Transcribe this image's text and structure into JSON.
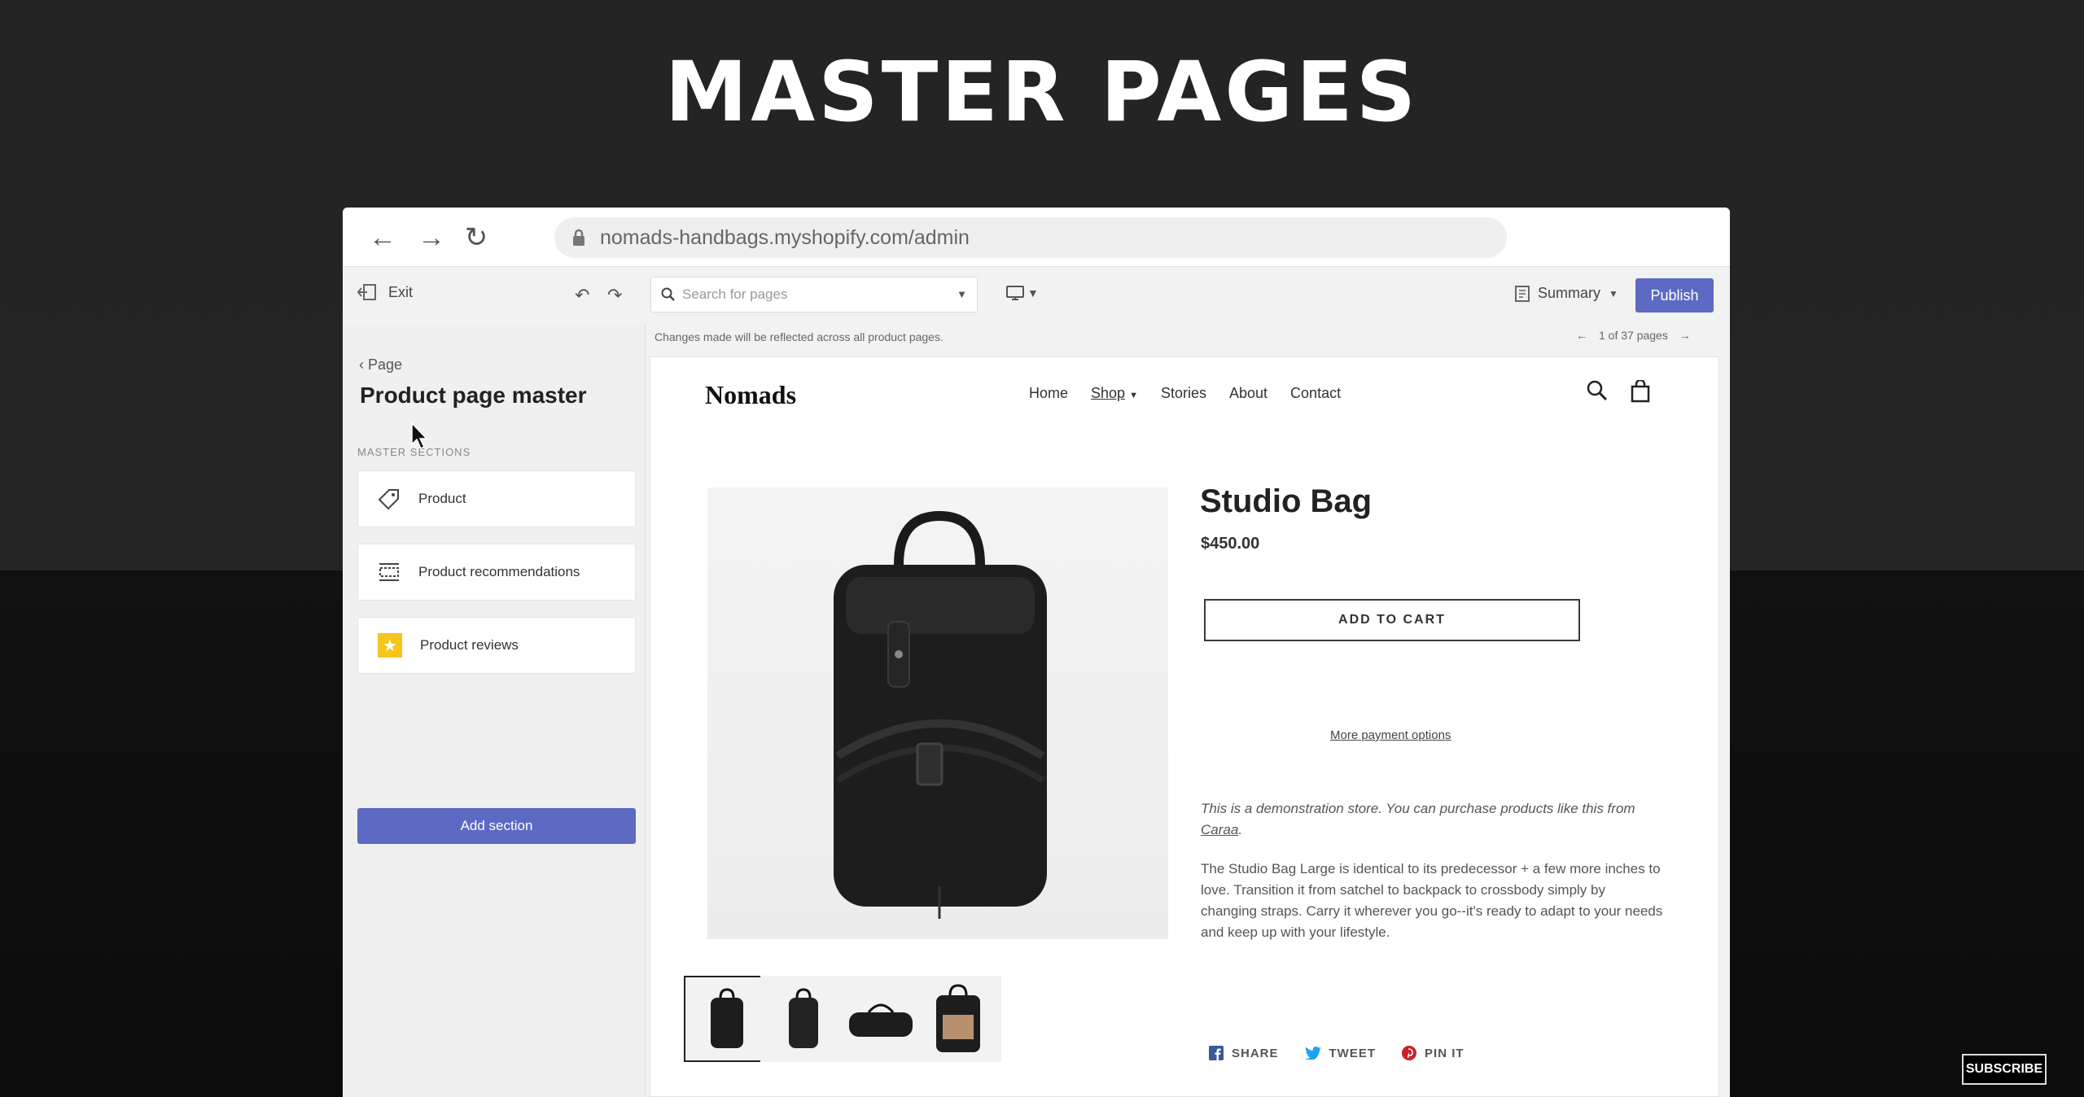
{
  "slide": {
    "title": "MASTER PAGES",
    "subscribe": "SUBSCRIBE"
  },
  "browser": {
    "url": "nomads-handbags.myshopify.com/admin"
  },
  "toolbar": {
    "exit": "Exit",
    "search_placeholder": "Search for pages",
    "summary": "Summary",
    "publish": "Publish"
  },
  "sidebar": {
    "back": "Page",
    "title": "Product page master",
    "section_label": "MASTER SECTIONS",
    "sections": [
      {
        "label": "Product",
        "icon": "tag-icon"
      },
      {
        "label": "Product recommendations",
        "icon": "layout-icon"
      },
      {
        "label": "Product reviews",
        "icon": "star-icon"
      }
    ],
    "add_section": "Add section"
  },
  "preview": {
    "notice": "Changes made will be reflected across all product pages.",
    "pager": "1 of 37 pages"
  },
  "store": {
    "logo": "Nomads",
    "nav": [
      "Home",
      "Shop",
      "Stories",
      "About",
      "Contact"
    ],
    "product": {
      "name": "Studio Bag",
      "price": "$450.00",
      "add_to_cart": "ADD TO CART",
      "more_payment": "More payment options",
      "demo_text": "This is a demonstration store. You can purchase products like this from",
      "demo_link": "Caraa",
      "description": "The Studio Bag Large is identical to its predecessor + a few more inches to love. Transition it from satchel to backpack to crossbody simply by changing straps. Carry it wherever you go--it's ready to adapt to your needs and keep up with your lifestyle."
    },
    "share": {
      "share": "SHARE",
      "tweet": "TWEET",
      "pin": "PIN IT"
    }
  },
  "colors": {
    "accent": "#5c6ac4",
    "star": "#f5c51b"
  }
}
